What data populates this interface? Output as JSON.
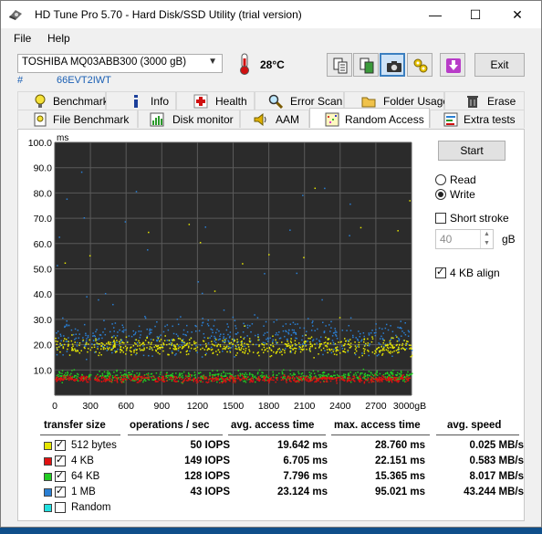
{
  "window": {
    "title": "HD Tune Pro 5.70 - Hard Disk/SSD Utility (trial version)",
    "controls": {
      "minimize": "—",
      "maximize": "☐",
      "close": "✕"
    }
  },
  "menu": {
    "file": "File",
    "help": "Help"
  },
  "toolbar": {
    "drive": "TOSHIBA MQ03ABB300 (3000 gB)",
    "serial_prefix": "#",
    "serial": "66EVT2IWT",
    "temperature": "28°C",
    "exit_label": "Exit",
    "icons": [
      "copy-text-icon",
      "copy-screenshot-icon",
      "camera-icon",
      "options-icon",
      "save-icon"
    ]
  },
  "tabs_row1": [
    {
      "label": "Benchmark",
      "icon": "lightbulb-icon"
    },
    {
      "label": "Info",
      "icon": "info-icon"
    },
    {
      "label": "Health",
      "icon": "health-icon"
    },
    {
      "label": "Error Scan",
      "icon": "magnifier-icon"
    },
    {
      "label": "Folder Usage",
      "icon": "folder-icon"
    },
    {
      "label": "Erase",
      "icon": "trash-icon"
    }
  ],
  "tabs_row2": [
    {
      "label": "File Benchmark",
      "icon": "file-benchmark-icon"
    },
    {
      "label": "Disk monitor",
      "icon": "disk-monitor-icon"
    },
    {
      "label": "AAM",
      "icon": "speaker-icon"
    },
    {
      "label": "Random Access",
      "icon": "random-access-icon",
      "active": true
    },
    {
      "label": "Extra tests",
      "icon": "extra-tests-icon"
    }
  ],
  "controls": {
    "start": "Start",
    "read": "Read",
    "write": "Write",
    "mode_selected": "Write",
    "short_stroke": "Short stroke",
    "short_stroke_checked": false,
    "stroke_value": "40",
    "stroke_unit": "gB",
    "align": "4 KB align",
    "align_checked": true
  },
  "chart_data": {
    "type": "scatter",
    "ylabel": "ms",
    "xlim": [
      0,
      3000
    ],
    "ylim": [
      0,
      100
    ],
    "x_ticks": [
      "0",
      "300",
      "600",
      "900",
      "1200",
      "1500",
      "1800",
      "2100",
      "2400",
      "2700",
      "3000gB"
    ],
    "y_ticks": [
      "100.0",
      "90.0",
      "80.0",
      "70.0",
      "60.0",
      "50.0",
      "40.0",
      "30.0",
      "20.0",
      "10.0"
    ],
    "grid": true,
    "background": "#2b2b2b",
    "series": [
      {
        "color": "#e6e600",
        "center_ms": 19.6,
        "spread_ms": 5
      },
      {
        "color": "#e01010",
        "center_ms": 6.7,
        "spread_ms": 2
      },
      {
        "color": "#22cc22",
        "center_ms": 7.8,
        "spread_ms": 3
      },
      {
        "color": "#2a7fd4",
        "center_ms": 23.1,
        "spread_ms": 10
      }
    ]
  },
  "results": {
    "headers": [
      "transfer size",
      "operations / sec",
      "avg. access time",
      "max. access time",
      "avg. speed"
    ],
    "rows": [
      {
        "color": "#e6e600",
        "checked": true,
        "size": "512 bytes",
        "ops": "50 IOPS",
        "avg": "19.642 ms",
        "max": "28.760 ms",
        "speed": "0.025 MB/s"
      },
      {
        "color": "#e01010",
        "checked": true,
        "size": "4 KB",
        "ops": "149 IOPS",
        "avg": "6.705 ms",
        "max": "22.151 ms",
        "speed": "0.583 MB/s"
      },
      {
        "color": "#22cc22",
        "checked": true,
        "size": "64 KB",
        "ops": "128 IOPS",
        "avg": "7.796 ms",
        "max": "15.365 ms",
        "speed": "8.017 MB/s"
      },
      {
        "color": "#2a7fd4",
        "checked": true,
        "size": "1 MB",
        "ops": "43 IOPS",
        "avg": "23.124 ms",
        "max": "95.021 ms",
        "speed": "43.244 MB/s"
      },
      {
        "color": "#22e0e0",
        "checked": false,
        "size": "Random",
        "ops": "",
        "avg": "",
        "max": "",
        "speed": ""
      }
    ]
  }
}
